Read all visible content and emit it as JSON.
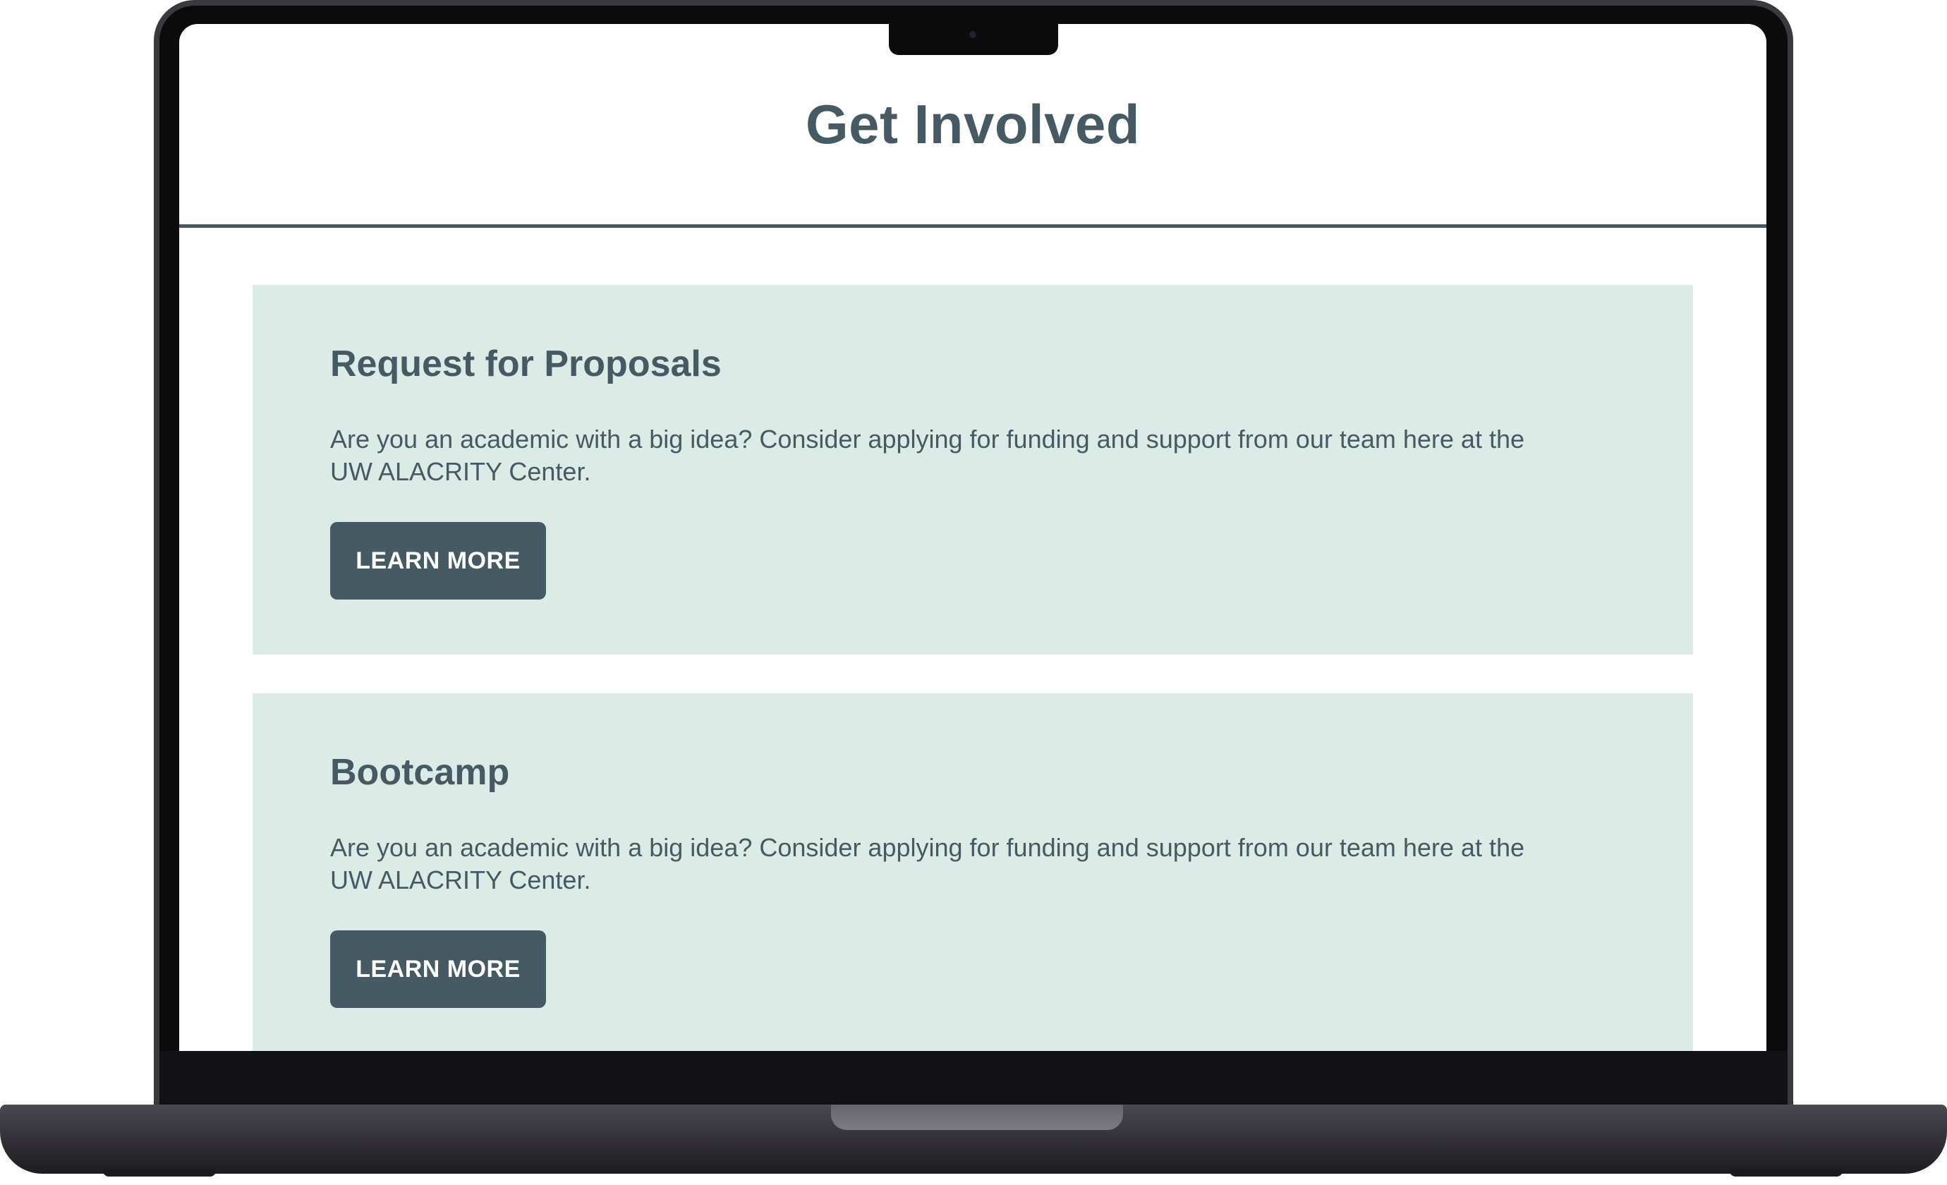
{
  "page": {
    "title": "Get Involved"
  },
  "cards": [
    {
      "title": "Request for Proposals",
      "text": "Are you an academic with a big idea? Consider applying for funding and support from our team here at the UW ALACRITY Center.",
      "button_label": "LEARN MORE"
    },
    {
      "title": "Bootcamp",
      "text": "Are you an academic with a big idea? Consider applying for funding and support from our team here at the UW ALACRITY Center.",
      "button_label": "LEARN MORE"
    }
  ],
  "colors": {
    "primary": "#455a63",
    "card_background": "#dbece7",
    "page_background": "#ffffff"
  }
}
